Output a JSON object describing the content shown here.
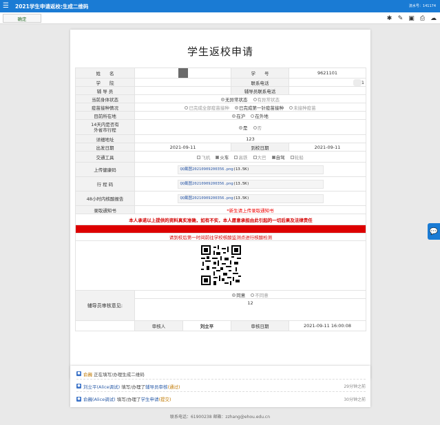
{
  "topbar": {
    "title": "2021学生申请返校:生成二维码",
    "serial": "流水号：141174"
  },
  "toolbar": {
    "confirm_label": "确定"
  },
  "form": {
    "title": "学生返校申请",
    "name_label": "姓　　名",
    "student_no_label": "学　　号",
    "student_no_value": "9621101",
    "college_label": "学　　院",
    "contact_phone_label": "联系电话",
    "contact_phone_value": "1",
    "counselor_label": "辅 导 员",
    "counselor_phone_label": "辅导员联系电话",
    "health_label": "当前身体状态",
    "health_options": [
      "无异常状态",
      "有异常状态"
    ],
    "vaccine_label": "疫苗接种情况",
    "vaccine_options": [
      "已完成全部疫苗接种",
      "已完成第一针疫苗接种",
      "未接种疫苗"
    ],
    "location_label": "目前所在地",
    "location_options": [
      "在沪",
      "在外地"
    ],
    "trip14_label_1": "14天内是否有",
    "trip14_label_2": "外省市行程",
    "trip14_options": [
      "是",
      "否"
    ],
    "address_label": "详细地址",
    "address_value": "123",
    "depart_label": "出发日期",
    "depart_value": "2021-09-11",
    "arrive_label": "到校日期",
    "arrive_value": "2021-09-11",
    "transport_label": "交通工具",
    "transport_options": [
      "飞机",
      "火车",
      "高铁",
      "大巴",
      "自驾",
      "轮船"
    ],
    "health_code_label": "上传健康码",
    "health_code_file": "QQ截图20210909200356.png",
    "health_code_size": "(13.5K)",
    "trip_code_label": "行 程 码",
    "trip_code_file": "QQ截图20210909200356.png",
    "trip_code_size": "(13.5K)",
    "nucleic_label": "48小时内核酸报告",
    "nucleic_file": "QQ截图20210909200356.png",
    "nucleic_size": "(13.5K)",
    "admission_label": "录取通知书",
    "admission_note": "*新生请上传录取通知书",
    "promise": "本人承诺以上提供的资料真实准确，如有不实，本人愿意承担由此引起的一切后果及法律责任",
    "notice": "请到校后第一时间前往学校核酸监测点进行核酸检测",
    "review_label": "辅导员审核意见:",
    "review_options": [
      "同意",
      "不同意"
    ],
    "review_comment": "12",
    "reviewer_label": "审核人",
    "reviewer_value": "刘立平",
    "review_date_label": "审核日期",
    "review_date_value": "2021-09-11 16:00:08"
  },
  "log": [
    {
      "who": "俞巍",
      "action": "正在填写/办理",
      "step": "生成二维码",
      "status": "",
      "time": ""
    },
    {
      "who": "刘立平(Alice调试)",
      "action": "填写/办理了",
      "step": "辅导员审核",
      "status": "(通过)",
      "time": "29分钟之前"
    },
    {
      "who": "俞巍(Alice调试)",
      "action": "填写/办理了",
      "step": "学生申请",
      "status": "(提交)",
      "time": "30分钟之前"
    }
  ],
  "footer": "联系电话：61900238 邮箱：zzhang@ehou.edu.cn",
  "colors": {
    "accent": "#1a7bd4",
    "danger": "#dd0000",
    "link": "#2b5ca8"
  }
}
